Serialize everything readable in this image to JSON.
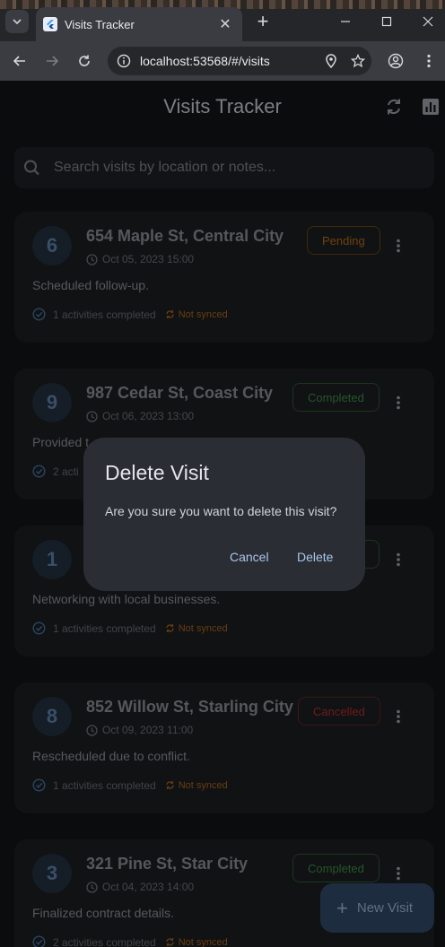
{
  "browser": {
    "tab_title": "Visits Tracker",
    "url": "localhost:53568/#/visits"
  },
  "app": {
    "title": "Visits Tracker",
    "search_placeholder": "Search visits by location or notes...",
    "fab_label": "New Visit"
  },
  "visits": [
    {
      "id": "6",
      "location": "654 Maple St, Central City",
      "date": "Oct 05, 2023 15:00",
      "status": "Pending",
      "notes": "Scheduled follow-up.",
      "activities": "1 activities completed",
      "sync": "Not synced"
    },
    {
      "id": "9",
      "location": "987 Cedar St, Coast City",
      "date": "Oct 06, 2023 13:00",
      "status": "Completed",
      "notes": "Provided t",
      "activities": "2 acti",
      "sync": ""
    },
    {
      "id": "1",
      "location": "",
      "date": "",
      "status": "",
      "notes": "Networking with local businesses.",
      "activities": "1 activities completed",
      "sync": "Not synced"
    },
    {
      "id": "8",
      "location": "852 Willow St, Starling City",
      "date": "Oct 09, 2023 11:00",
      "status": "Cancelled",
      "notes": "Rescheduled due to conflict.",
      "activities": "1 activities completed",
      "sync": "Not synced"
    },
    {
      "id": "3",
      "location": "321 Pine St, Star City",
      "date": "Oct 04, 2023 14:00",
      "status": "Completed",
      "notes": "Finalized contract details.",
      "activities": "2 activities completed",
      "sync": "Not synced"
    }
  ],
  "dialog": {
    "title": "Delete Visit",
    "message": "Are you sure you want to delete this visit?",
    "cancel_label": "Cancel",
    "delete_label": "Delete"
  },
  "colors": {
    "pending": "#b56b16",
    "completed": "#3f8a47",
    "cancelled": "#b32c2c",
    "accent": "#a9c6ec"
  }
}
